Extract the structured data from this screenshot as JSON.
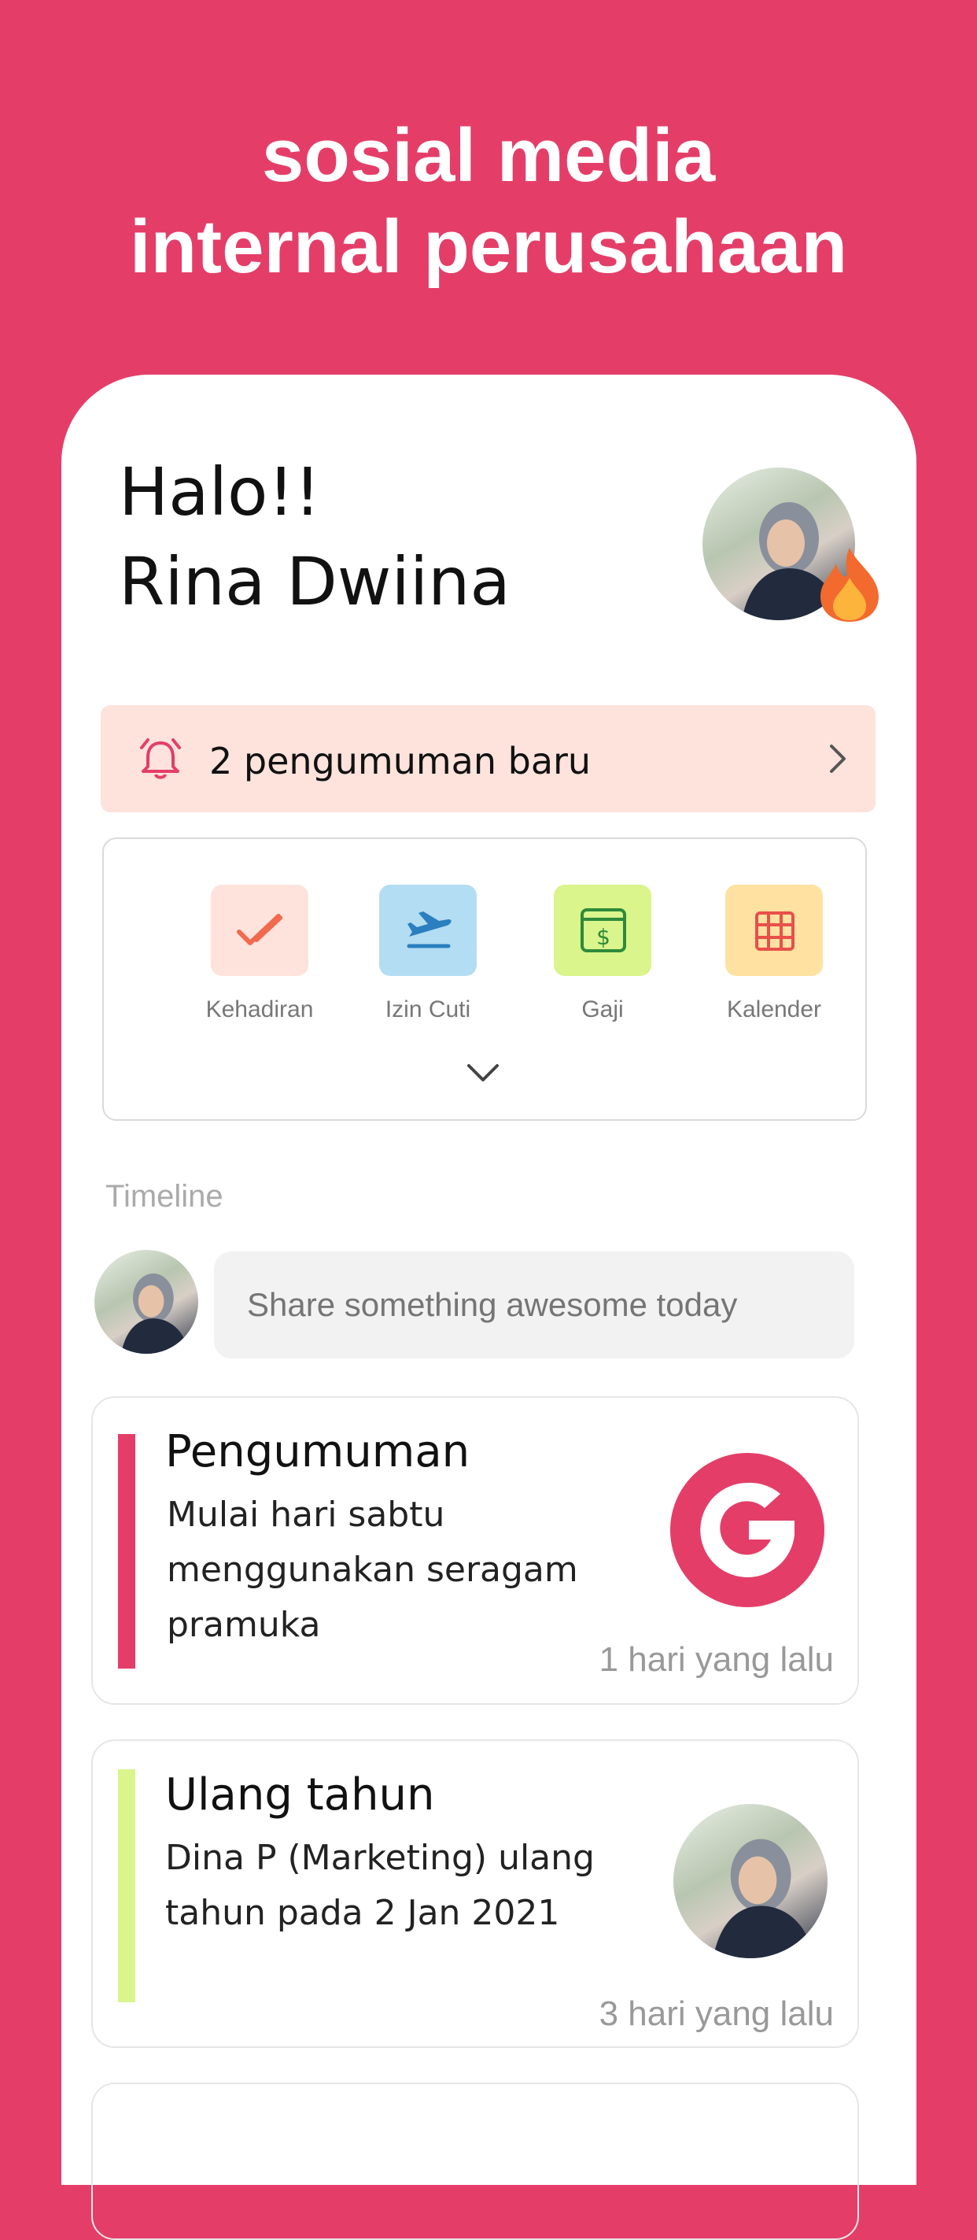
{
  "headline": {
    "line1": "sosial media",
    "line2": "internal perusahaan"
  },
  "greeting": {
    "hello": "Halo!!",
    "name": "Rina Dwiina"
  },
  "announcement": {
    "label": "2 pengumuman baru"
  },
  "menu": {
    "items": [
      {
        "label": "Kehadiran",
        "icon": "check-icon",
        "color": "#FDE3DB"
      },
      {
        "label": "Izin Cuti",
        "icon": "plane-departure-icon",
        "color": "#B3DDF2"
      },
      {
        "label": "Gaji",
        "icon": "salary-icon",
        "color": "#D9F58B"
      },
      {
        "label": "Kalender",
        "icon": "calendar-grid-icon",
        "color": "#FFE1A1"
      }
    ]
  },
  "timeline": {
    "title": "Timeline",
    "share_placeholder": "Share something awesome today"
  },
  "posts": [
    {
      "title": "Pengumuman",
      "body": "Mulai hari sabtu menggunakan seragam pramuka",
      "time": "1 hari yang lalu",
      "accent": "#E43E68"
    },
    {
      "title": "Ulang tahun",
      "body": "Dina P (Marketing) ulang tahun pada  2 Jan 2021",
      "time": "3 hari yang lalu",
      "accent": "#D9F58B"
    }
  ],
  "colors": {
    "brand": "#E43E68",
    "announce_bg": "#FDE3DB"
  }
}
